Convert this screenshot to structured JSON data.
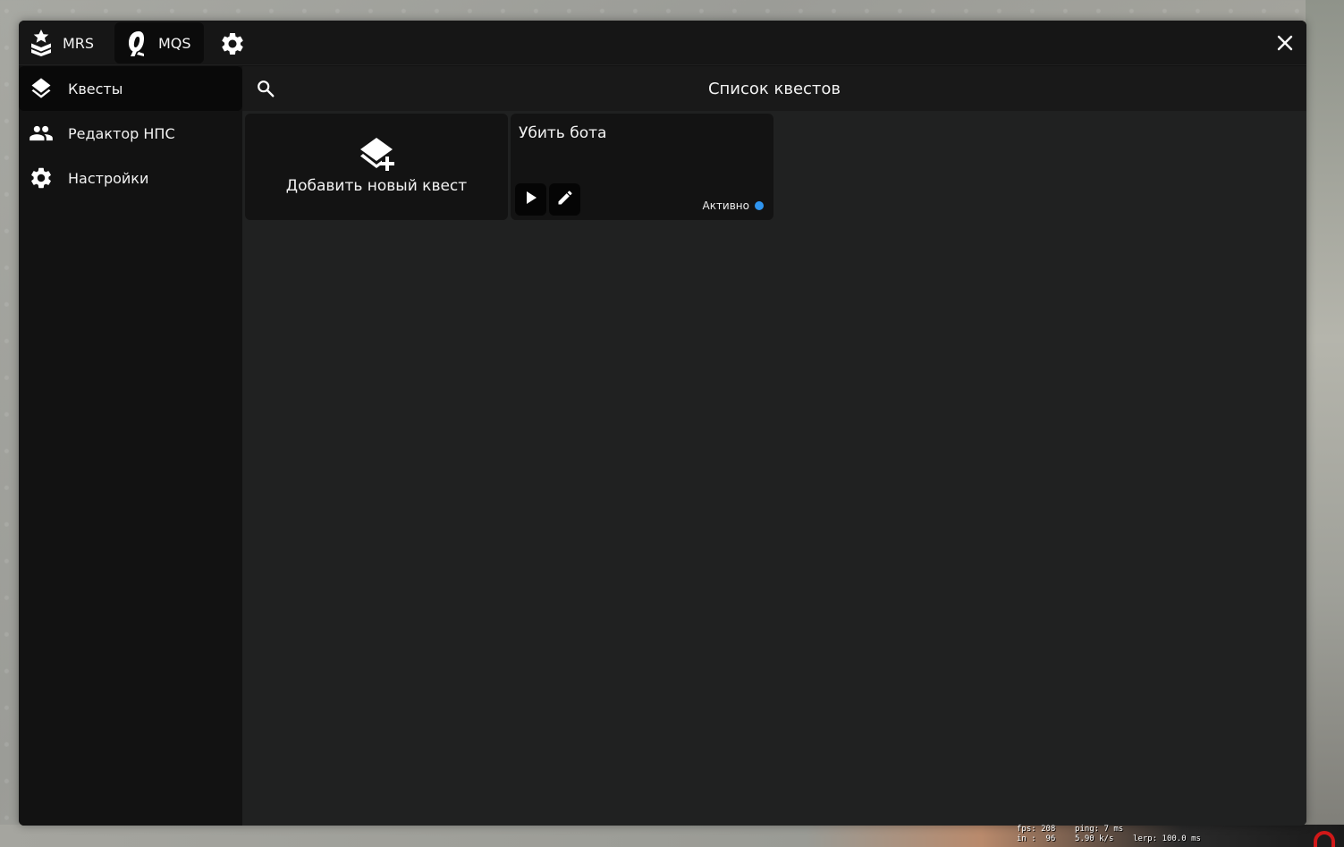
{
  "topbar": {
    "tabs": [
      {
        "label": "MRS",
        "icon": "rank-icon",
        "active": false
      },
      {
        "label": "MQS",
        "icon": "quest-logo-icon",
        "active": true
      }
    ],
    "settings_icon": "gear-icon",
    "close_icon": "close-icon"
  },
  "sidebar": {
    "items": [
      {
        "label": "Квесты",
        "icon": "layers-icon",
        "active": true
      },
      {
        "label": "Редактор НПС",
        "icon": "people-icon",
        "active": false
      },
      {
        "label": "Настройки",
        "icon": "gear-icon",
        "active": false
      }
    ]
  },
  "main": {
    "title": "Список квестов",
    "search_icon": "search-icon",
    "add_card": {
      "label": "Добавить новый квест",
      "icon": "layers-plus-icon"
    },
    "quests": [
      {
        "title": "Убить бота",
        "status": "Активно",
        "status_color": "#2f95f0"
      }
    ]
  },
  "netgraph": {
    "line1": "fps: 208    ping: 7 ms",
    "line2": "in :  96    5.90 k/s    lerp: 100.0 ms"
  },
  "colors": {
    "window_bg": "#131313",
    "content_bg": "#202121",
    "accent": "#2f95f0"
  }
}
